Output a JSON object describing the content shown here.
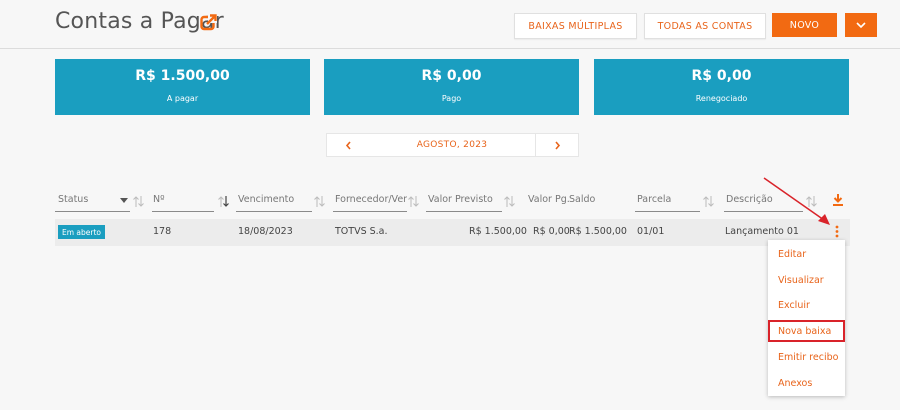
{
  "header": {
    "title": "Contas a Pagar",
    "buttons": {
      "baixas_multiplas": "BAIXAS MÚLTIPLAS",
      "todas_contas": "TODAS AS CONTAS",
      "novo": "NOVO"
    }
  },
  "summary": [
    {
      "amount": "R$ 1.500,00",
      "label": "A pagar"
    },
    {
      "amount": "R$ 0,00",
      "label": "Pago"
    },
    {
      "amount": "R$ 0,00",
      "label": "Renegociado"
    }
  ],
  "period": {
    "label": "AGOSTO, 2023"
  },
  "table": {
    "columns": [
      "Status",
      "Nº",
      "Vencimento",
      "Fornecedor/Vendedor",
      "Valor Previsto",
      "Valor Pg.",
      "Saldo",
      "Parcela",
      "Descrição"
    ],
    "rows": [
      {
        "status": "Em aberto",
        "numero": "178",
        "vencimento": "18/08/2023",
        "fornecedor": "TOTVS S.a.",
        "valor_previsto": "R$ 1.500,00",
        "valor_pago": "R$ 0,00",
        "saldo": "R$ 1.500,00",
        "parcela": "01/01",
        "descricao": "Lançamento 01"
      }
    ]
  },
  "row_menu": {
    "items": [
      "Editar",
      "Visualizar",
      "Excluir",
      "Nova baixa",
      "Emitir recibo",
      "Anexos"
    ]
  },
  "colors": {
    "accent": "#f26a12",
    "card": "#1a9ec0",
    "highlight": "#d9232a"
  }
}
